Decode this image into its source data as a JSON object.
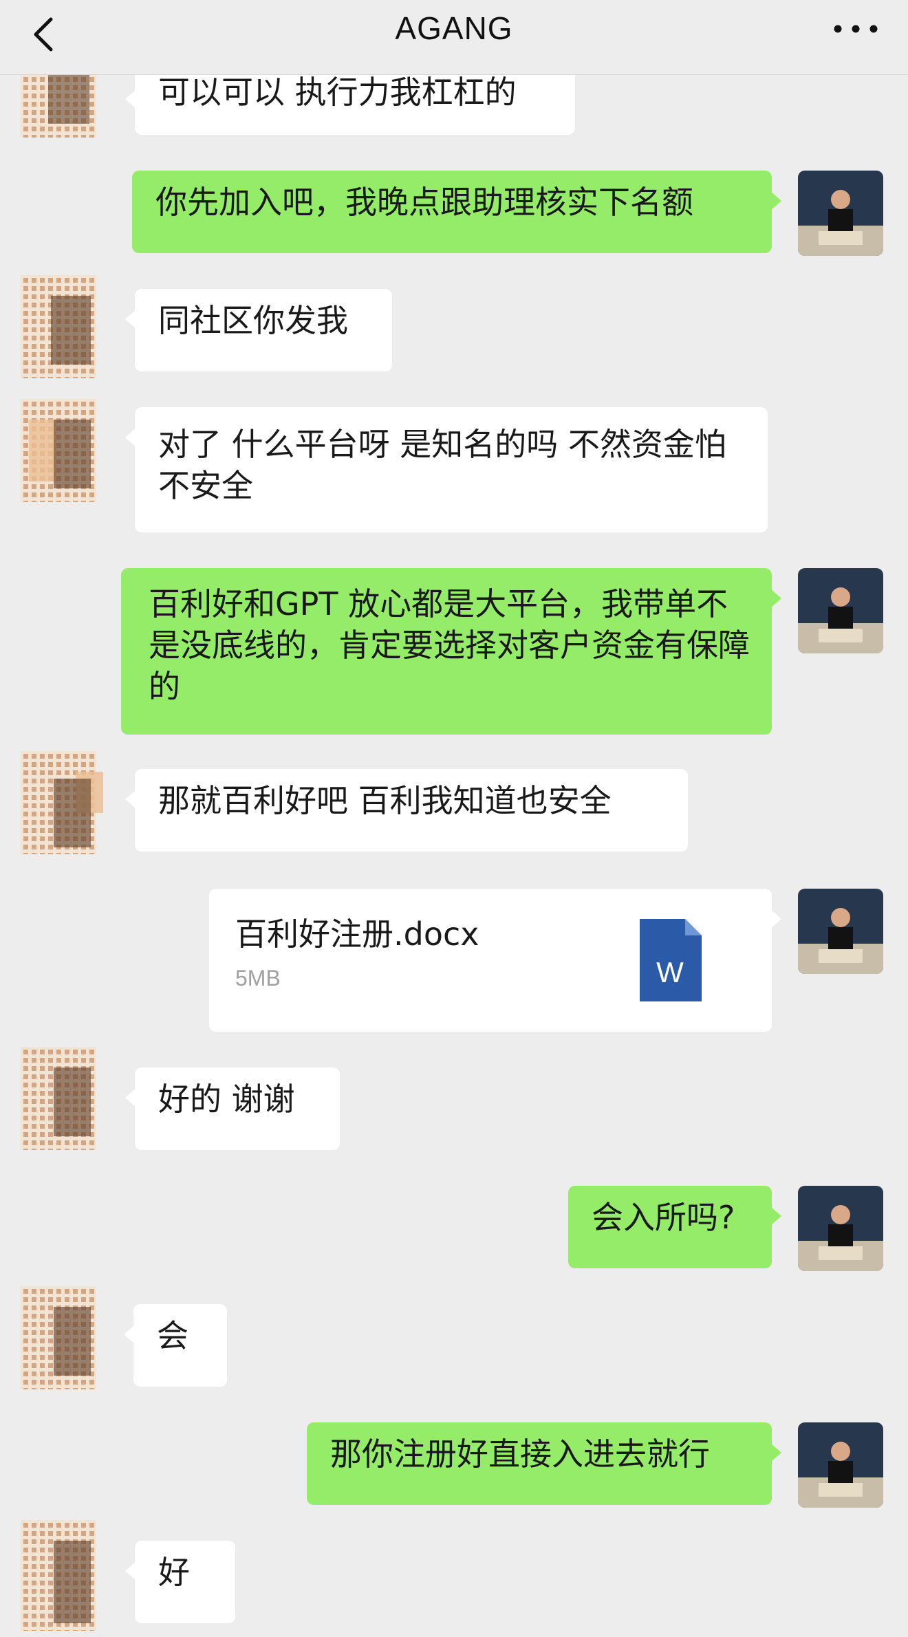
{
  "header": {
    "title": "AGANG",
    "back_icon": "chevron-left-icon",
    "more_icon": "ellipsis-icon"
  },
  "colors": {
    "background": "#ededed",
    "incoming_bubble": "#ffffff",
    "outgoing_bubble": "#95ec69",
    "word_icon": "#2b5ba8"
  },
  "messages": [
    {
      "side": "in",
      "text": "可以可以 执行力我杠杠的"
    },
    {
      "side": "out",
      "text": "你先加入吧，我晚点跟助理核实下名额"
    },
    {
      "side": "in",
      "text": "同社区你发我"
    },
    {
      "side": "in",
      "text": "对了 什么平台呀 是知名的吗 不然资金怕不安全"
    },
    {
      "side": "out",
      "text": "百利好和GPT 放心都是大平台，我带单不是没底线的，肯定要选择对客户资金有保障的"
    },
    {
      "side": "in",
      "text": "那就百利好吧 百利我知道也安全"
    },
    {
      "side": "out",
      "type": "file",
      "file_name": "百利好注册.docx",
      "file_size": "5MB",
      "file_icon": "word-doc-icon",
      "file_icon_letter": "W"
    },
    {
      "side": "in",
      "text": "好的 谢谢"
    },
    {
      "side": "out",
      "text": "会入所吗?"
    },
    {
      "side": "in",
      "text": "会"
    },
    {
      "side": "out",
      "text": "那你注册好直接入进去就行"
    },
    {
      "side": "in",
      "text": "好"
    }
  ]
}
